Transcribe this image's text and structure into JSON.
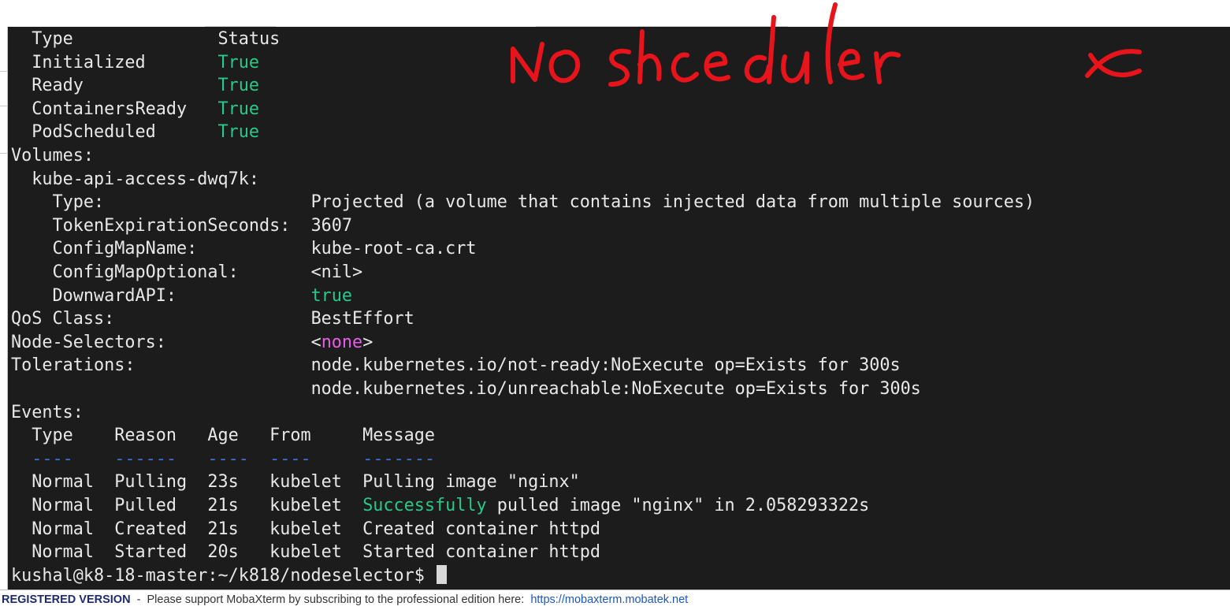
{
  "terminal": {
    "lines": [
      [
        {
          "t": "  Type              "
        },
        {
          "t": "Status"
        }
      ],
      [
        {
          "t": "  Initialized       "
        },
        {
          "t": "True",
          "c": "g"
        }
      ],
      [
        {
          "t": "  Ready             "
        },
        {
          "t": "True",
          "c": "g"
        }
      ],
      [
        {
          "t": "  ContainersReady   "
        },
        {
          "t": "True",
          "c": "g"
        }
      ],
      [
        {
          "t": "  PodScheduled      "
        },
        {
          "t": "True",
          "c": "g"
        }
      ],
      [
        {
          "t": "Volumes:"
        }
      ],
      [
        {
          "t": "  kube-api-access-dwq7k:"
        }
      ],
      [
        {
          "t": "    Type:                    "
        },
        {
          "t": "Projected (a volume that contains injected data from multiple sources)"
        }
      ],
      [
        {
          "t": "    TokenExpirationSeconds:  "
        },
        {
          "t": "3607"
        }
      ],
      [
        {
          "t": "    ConfigMapName:           "
        },
        {
          "t": "kube-root-ca.crt"
        }
      ],
      [
        {
          "t": "    ConfigMapOptional:       "
        },
        {
          "t": "<nil>"
        }
      ],
      [
        {
          "t": "    DownwardAPI:             "
        },
        {
          "t": "true",
          "c": "g"
        }
      ],
      [
        {
          "t": "QoS Class:                   "
        },
        {
          "t": "BestEffort"
        }
      ],
      [
        {
          "t": "Node-Selectors:              "
        },
        {
          "t": "<"
        },
        {
          "t": "none",
          "c": "m"
        },
        {
          "t": ">"
        }
      ],
      [
        {
          "t": "Tolerations:                 "
        },
        {
          "t": "node.kubernetes.io/not-ready:NoExecute op=Exists for 300s"
        }
      ],
      [
        {
          "t": "                             "
        },
        {
          "t": "node.kubernetes.io/unreachable:NoExecute op=Exists for 300s"
        }
      ],
      [
        {
          "t": "Events:"
        }
      ],
      [
        {
          "t": "  Type    Reason   Age   From     Message"
        }
      ],
      [
        {
          "t": "  "
        },
        {
          "t": "----",
          "c": "b"
        },
        {
          "t": "    "
        },
        {
          "t": "------",
          "c": "b"
        },
        {
          "t": "   "
        },
        {
          "t": "----",
          "c": "b"
        },
        {
          "t": "  "
        },
        {
          "t": "----",
          "c": "b"
        },
        {
          "t": "     "
        },
        {
          "t": "-------",
          "c": "b"
        }
      ],
      [
        {
          "t": "  Normal  Pulling  23s   kubelet  Pulling image \"nginx\""
        }
      ],
      [
        {
          "t": "  Normal  Pulled   21s   kubelet  "
        },
        {
          "t": "Successfully",
          "c": "g"
        },
        {
          "t": " pulled image \"nginx\" in 2.058293322s"
        }
      ],
      [
        {
          "t": "  Normal  Created  21s   kubelet  Created container httpd"
        }
      ],
      [
        {
          "t": "  Normal  Started  20s   kubelet  Started container httpd"
        }
      ],
      [
        {
          "t": "kushal@k8-18-master:~/k818/nodeselector$ "
        }
      ]
    ]
  },
  "status_bar": {
    "registered": "REGISTERED VERSION",
    "message": "  -  Please support MobaXterm by subscribing to the professional edition here:  ",
    "link": "https://mobaxterm.mobatek.net"
  },
  "colors": {
    "terminal_bg": "#1c1c1c",
    "terminal_fg": "#e8e8e8",
    "ok_green": "#28c98a",
    "magenta": "#e85de8",
    "dash_blue": "#3b6fd4",
    "annotation_red": "#e8141c"
  }
}
